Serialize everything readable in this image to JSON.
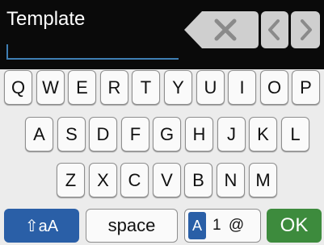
{
  "input": {
    "value": "Template"
  },
  "controls": {
    "backspace_icon": "backspace-icon",
    "prev_icon": "chevron-left-icon",
    "next_icon": "chevron-right-icon"
  },
  "keyboard": {
    "row1": [
      "Q",
      "W",
      "E",
      "R",
      "T",
      "Y",
      "U",
      "I",
      "O",
      "P"
    ],
    "row2": [
      "A",
      "S",
      "D",
      "F",
      "G",
      "H",
      "J",
      "K",
      "L"
    ],
    "row3": [
      "Z",
      "X",
      "C",
      "V",
      "B",
      "N",
      "M"
    ],
    "shift_label": "⇧aA",
    "space_label": "space",
    "mode_highlight": "A",
    "mode_rest": "1 @",
    "ok_label": "OK"
  },
  "colors": {
    "header_bg": "#0a0a0a",
    "accent_blue": "#2a5fa7",
    "ok_green": "#3d8b3d",
    "keyboard_bg": "#ececec"
  }
}
